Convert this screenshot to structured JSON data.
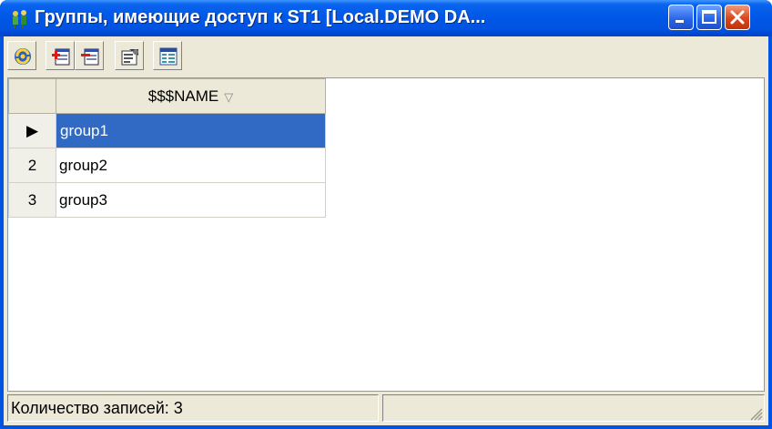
{
  "window": {
    "title": "Группы, имеющие доступ к ST1 [Local.DEMO DA...",
    "title_color": "#ffffff",
    "titlebar_color": "#0058e6",
    "buttons": [
      "minimize-icon",
      "maximize-icon",
      "close-icon"
    ]
  },
  "toolbar": {
    "buttons": [
      {
        "name": "refresh",
        "icon": "refresh-icon"
      },
      {
        "name": "add-group",
        "icon": "add-icon"
      },
      {
        "name": "remove-group",
        "icon": "remove-icon"
      },
      {
        "name": "properties",
        "icon": "properties-icon"
      },
      {
        "name": "grid-view",
        "icon": "grid-icon"
      }
    ]
  },
  "grid": {
    "column_header": "$$$NAME",
    "sort_indicator": "▽",
    "rows": [
      {
        "row_label": "▶",
        "name": "group1",
        "selected": true
      },
      {
        "row_label": "2",
        "name": "group2",
        "selected": false
      },
      {
        "row_label": "3",
        "name": "group3",
        "selected": false
      }
    ],
    "selection_color": "#316ac5"
  },
  "status": {
    "record_count": "Количество записей: 3",
    "second_pane": ""
  }
}
